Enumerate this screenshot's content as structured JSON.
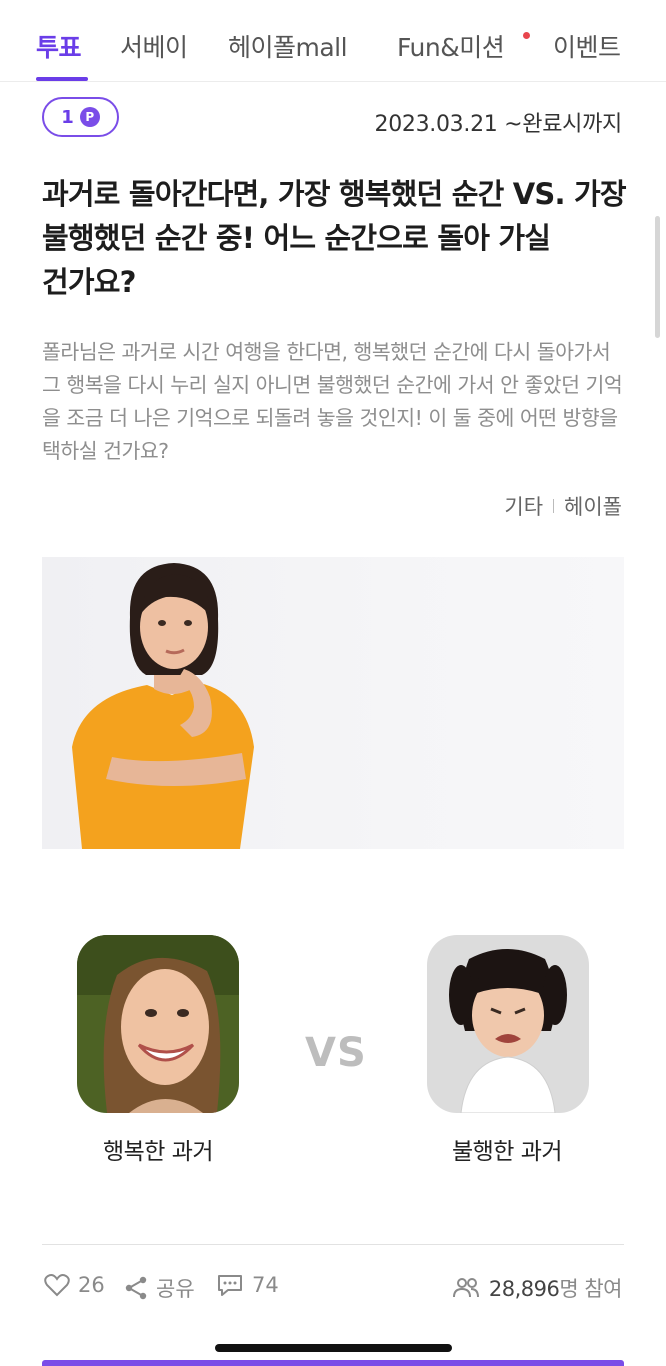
{
  "tabs": [
    {
      "label": "투표",
      "active": true
    },
    {
      "label": "서베이",
      "active": false
    },
    {
      "label": "헤이폴mall",
      "active": false
    },
    {
      "label": "Fun&미션",
      "active": false,
      "has_notification_dot": true
    },
    {
      "label": "이벤트",
      "active": false
    }
  ],
  "badge": {
    "count": "1",
    "icon": "point-icon",
    "icon_letter": "P"
  },
  "period": "2023.03.21 ~완료시까지",
  "poll": {
    "title": "과거로 돌아간다면, 가장 행복했던 순간 VS. 가장 불행했던 순간 중! 어느 순간으로 돌아 가실 건가요?",
    "description": "폴라님은 과거로 시간 여행을 한다면, 행복했던 순간에 다시 돌아가서 그 행복을 다시 누리 실지 아니면 불행했던 순간에 가서 안 좋았던 기억을 조금 더 나은 기억으로 되돌려 놓을 것인지! 이 둘 중에 어떤 방향을 택하실 건가요?",
    "category": "기타",
    "author": "헤이폴"
  },
  "options": {
    "left": {
      "label": "행복한 과거"
    },
    "vs": "VS",
    "right": {
      "label": "불행한 과거"
    }
  },
  "stats": {
    "likes": "26",
    "share_label": "공유",
    "comments": "74",
    "participants": "28,896",
    "participants_unit": "명 참여"
  },
  "colors": {
    "accent": "#6a3de8",
    "notification": "#e8454d"
  }
}
